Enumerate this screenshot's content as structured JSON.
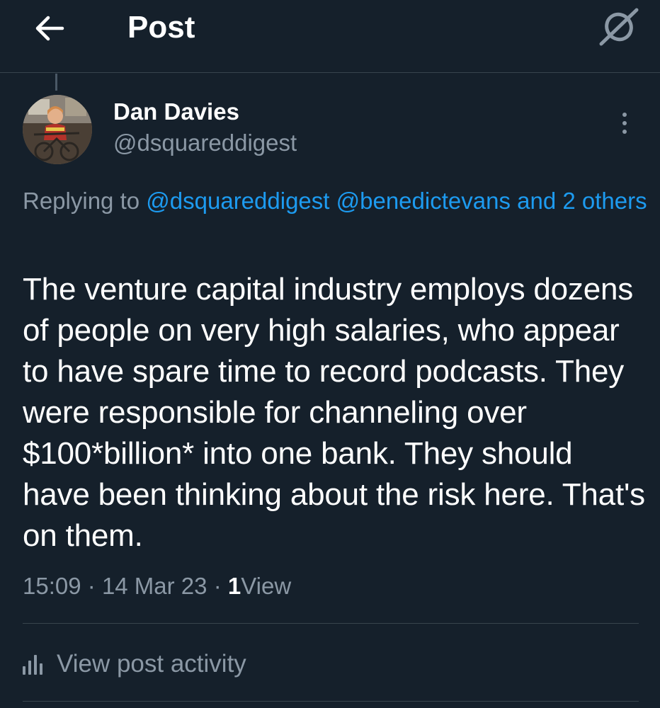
{
  "header": {
    "back_icon": "arrow-left-icon",
    "title": "Post",
    "grok_icon": "grok-icon"
  },
  "post": {
    "author": {
      "name": "Dan Davies",
      "handle": "@dsquareddigest",
      "avatar_icon": "avatar"
    },
    "more_icon": "more-vertical-icon",
    "replying": {
      "prefix": "Replying to",
      "mentions": [
        "@dsquareddigest",
        "@benedictevans"
      ],
      "connector": "and",
      "others": "2 others"
    },
    "text": "The venture capital industry employs dozens of people on very high salaries, who appear to have spare time to record podcasts. They were responsible for channeling over $100*billion* into one bank. They should have been thinking about the risk here. That's on them.",
    "time": "15:09",
    "date": "14 Mar 23",
    "separator": "·",
    "views_count": "1",
    "views_label": "View"
  },
  "activity": {
    "label": "View post activity",
    "icon": "bar-chart-icon"
  },
  "colors": {
    "background": "#15202b",
    "text": "#ffffff",
    "secondary": "#8b98a5",
    "link": "#1d9bf0",
    "divider": "#38444d"
  }
}
